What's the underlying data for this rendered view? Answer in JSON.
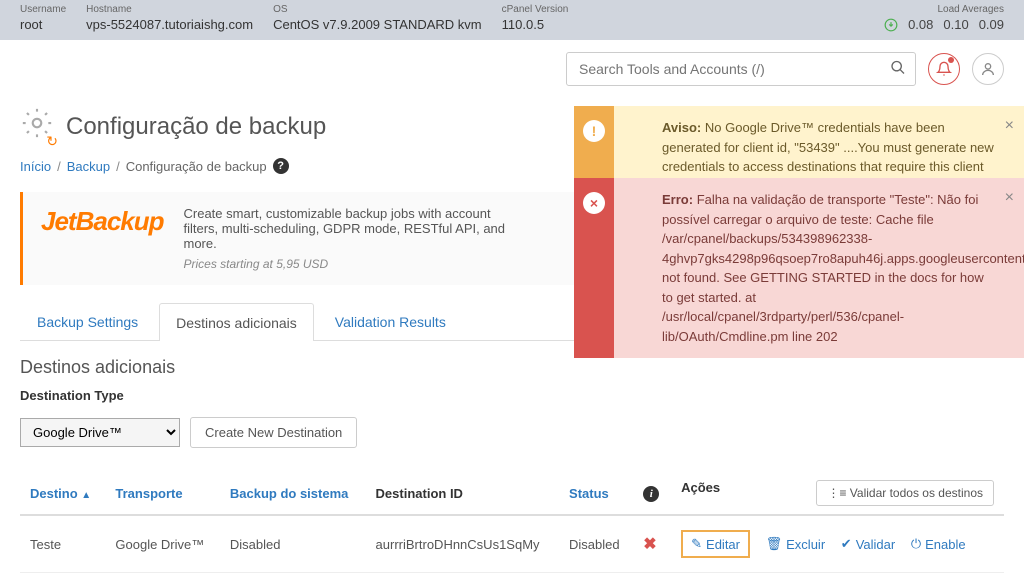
{
  "topbar": {
    "user_label": "Username",
    "user_value": "root",
    "host_label": "Hostname",
    "host_value": "vps-5524087.tutoriaishg.com",
    "os_label": "OS",
    "os_value": "CentOS v7.9.2009 STANDARD kvm",
    "cp_label": "cPanel Version",
    "cp_value": "110.0.5",
    "load_label": "Load Averages",
    "load1": "0.08",
    "load2": "0.10",
    "load3": "0.09"
  },
  "search": {
    "placeholder": "Search Tools and Accounts (/)"
  },
  "page": {
    "title": "Configuração de backup"
  },
  "breadcrumb": {
    "home": "Início",
    "backup": "Backup",
    "current": "Configuração de backup"
  },
  "alerts": {
    "warn_title": "Aviso:",
    "warn_body": "No Google Drive™ credentials have been generated for client id, \"53439\" ....You must generate new credentials to access destinations that require this client ID.",
    "err_title": "Erro:",
    "err_body": "Falha na validação de transporte \"Teste\": Não foi possível carregar o arquivo de teste: Cache file /var/cpanel/backups/534398962338-4ghvp7gks4298p96qsoep7ro8apuh46j.apps.googleusercontent.com.yml not found. See GETTING STARTED in the docs for how to get started. at /usr/local/cpanel/3rdparty/perl/536/cpanel-lib/OAuth/Cmdline.pm line 202"
  },
  "promo": {
    "logo": "JetBackup",
    "text": "Create smart, customizable backup jobs with account filters, multi-scheduling, GDPR mode, RESTful API, and more.",
    "price": "Prices starting at 5,95 USD"
  },
  "tabs": {
    "t1": "Backup Settings",
    "t2": "Destinos adicionais",
    "t3": "Validation Results"
  },
  "section": {
    "title": "Destinos adicionais",
    "type_label": "Destination Type",
    "select_value": "Google Drive™",
    "create_btn": "Create New Destination"
  },
  "table": {
    "h_destino": "Destino",
    "h_transporte": "Transporte",
    "h_backup": "Backup do sistema",
    "h_destid": "Destination ID",
    "h_status": "Status",
    "h_acoes": "Ações",
    "validate_all": "Validar todos os destinos",
    "row": {
      "destino": "Teste",
      "transporte": "Google Drive™",
      "backup": "Disabled",
      "destid": "aurrriBrtroDHnnCsUs1SqMy",
      "status": "Disabled",
      "editar": "Editar",
      "excluir": "Excluir",
      "validar": "Validar",
      "enable": "Enable"
    }
  }
}
